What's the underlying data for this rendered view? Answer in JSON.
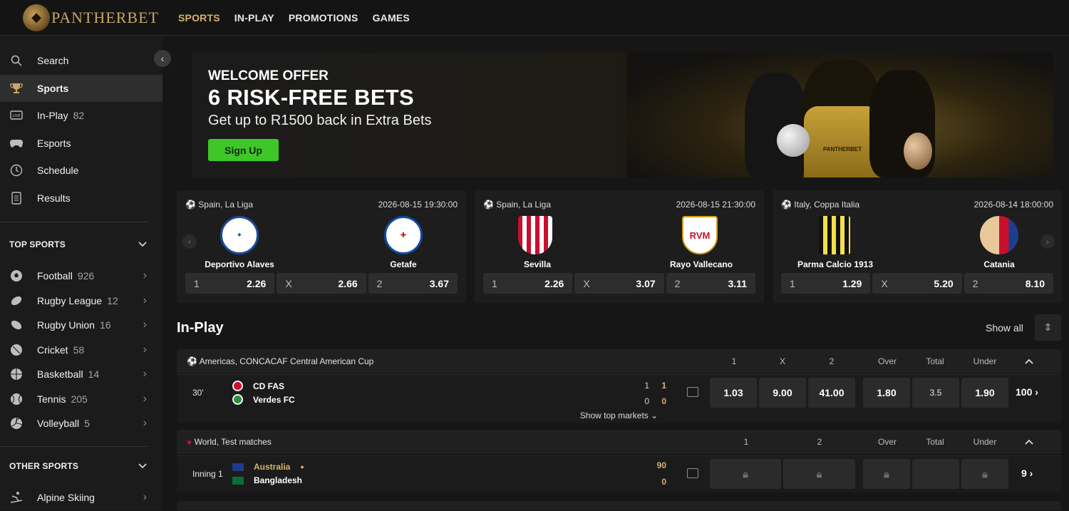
{
  "brand": {
    "name": "PANTHERBET"
  },
  "nav": [
    {
      "label": "SPORTS",
      "active": true
    },
    {
      "label": "IN-PLAY",
      "active": false
    },
    {
      "label": "PROMOTIONS",
      "active": false
    },
    {
      "label": "GAMES",
      "active": false
    }
  ],
  "sidebar": {
    "items": [
      {
        "label": "Search",
        "count": "",
        "icon": "search-icon"
      },
      {
        "label": "Sports",
        "count": "",
        "icon": "trophy-icon"
      },
      {
        "label": "In-Play",
        "count": "82",
        "icon": "live-icon"
      },
      {
        "label": "Esports",
        "count": "",
        "icon": "gamepad-icon"
      },
      {
        "label": "Schedule",
        "count": "",
        "icon": "clock-icon"
      },
      {
        "label": "Results",
        "count": "",
        "icon": "document-icon"
      }
    ],
    "top_sports_title": "TOP SPORTS",
    "top_sports": [
      {
        "label": "Football",
        "count": "926",
        "icon": "football-icon"
      },
      {
        "label": "Rugby League",
        "count": "12",
        "icon": "rugby-league-icon"
      },
      {
        "label": "Rugby Union",
        "count": "16",
        "icon": "rugby-union-icon"
      },
      {
        "label": "Cricket",
        "count": "58",
        "icon": "cricket-icon"
      },
      {
        "label": "Basketball",
        "count": "14",
        "icon": "basketball-icon"
      },
      {
        "label": "Tennis",
        "count": "205",
        "icon": "tennis-icon"
      },
      {
        "label": "Volleyball",
        "count": "5",
        "icon": "volleyball-icon"
      }
    ],
    "other_sports_title": "OTHER SPORTS",
    "other_sports": [
      {
        "label": "Alpine Skiing",
        "icon": "skiing-icon"
      }
    ]
  },
  "banner": {
    "line1": "WELCOME OFFER",
    "line2": "6 RISK-FREE BETS",
    "line3": "Get up to R1500 back in Extra Bets",
    "cta": "Sign Up",
    "shirt_text": "PANTHERBET"
  },
  "featured": [
    {
      "league": "Spain, La Liga",
      "time": "2026-08-15 19:30:00",
      "home": "Deportivo Alaves",
      "away": "Getafe",
      "odds": [
        {
          "label": "1",
          "value": "2.26"
        },
        {
          "label": "X",
          "value": "2.66"
        },
        {
          "label": "2",
          "value": "3.67"
        }
      ]
    },
    {
      "league": "Spain, La Liga",
      "time": "2026-08-15 21:30:00",
      "home": "Sevilla",
      "away": "Rayo Vallecano",
      "odds": [
        {
          "label": "1",
          "value": "2.26"
        },
        {
          "label": "X",
          "value": "3.07"
        },
        {
          "label": "2",
          "value": "3.11"
        }
      ]
    },
    {
      "league": "Italy, Coppa Italia",
      "time": "2026-08-14 18:00:00",
      "home": "Parma Calcio 1913",
      "away": "Catania",
      "odds": [
        {
          "label": "1",
          "value": "1.29"
        },
        {
          "label": "X",
          "value": "5.20"
        },
        {
          "label": "2",
          "value": "8.10"
        }
      ]
    }
  ],
  "inplay": {
    "title": "In-Play",
    "show_all": "Show all",
    "events": [
      {
        "league": "Americas, CONCACAF Central American Cup",
        "columns": [
          "1",
          "X",
          "2",
          "Over",
          "Total",
          "Under"
        ],
        "clock": "30'",
        "home": "CD FAS",
        "away": "Verdes FC",
        "home_scores": [
          "1",
          "1"
        ],
        "away_scores": [
          "0",
          "0"
        ],
        "odds": [
          "1.03",
          "9.00",
          "41.00",
          "1.80",
          "3.5",
          "1.90"
        ],
        "more": "100",
        "show_top": "Show top markets"
      },
      {
        "league": "World, Test matches",
        "columns": [
          "1",
          "2",
          "Over",
          "Total",
          "Under"
        ],
        "clock": "Inning 1",
        "home": "Australia",
        "away": "Bangladesh",
        "home_score": "90",
        "away_score": "0",
        "more": "9"
      }
    ]
  },
  "colors": {
    "accent": "#d9b26a",
    "cta": "#3fc729",
    "bg": "#161616"
  }
}
